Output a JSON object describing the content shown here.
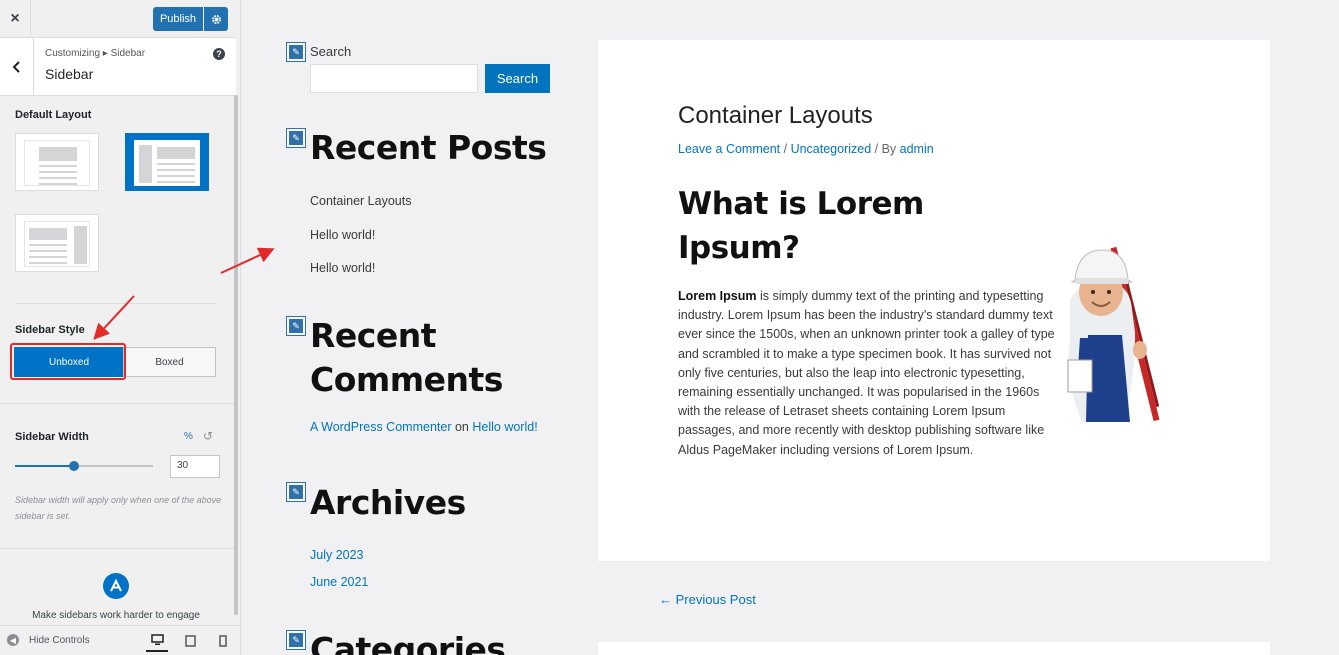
{
  "header": {
    "close_icon": "×",
    "publish_label": "Publish",
    "settings_icon": "gear-icon"
  },
  "section": {
    "breadcrumb": "Customizing ▸ Sidebar",
    "title": "Sidebar"
  },
  "controls": {
    "default_layout_label": "Default Layout",
    "selected_layout_index": 1,
    "sidebar_style_label": "Sidebar Style",
    "style_options": [
      "Unboxed",
      "Boxed"
    ],
    "selected_style": "Unboxed",
    "sidebar_width_label": "Sidebar Width",
    "width_unit": "%",
    "width_value": "30",
    "width_fraction": 0.43,
    "width_help": "Sidebar width will apply only when one of the above sidebar is set.",
    "promo_text": "Make sidebars work harder to engage"
  },
  "footer": {
    "hide_controls_label": "Hide Controls"
  },
  "preview": {
    "search_label": "Search",
    "search_button": "Search",
    "recent_posts_title": "Recent Posts",
    "recent_posts": [
      "Container Layouts",
      "Hello world!",
      "Hello world!"
    ],
    "recent_comments_title": "Recent Comments",
    "comment_author": "A WordPress Commenter",
    "comment_on": "on",
    "comment_post": "Hello world!",
    "archives_title": "Archives",
    "archives": [
      "July 2023",
      "June 2021"
    ],
    "categories_title": "Categories",
    "post_title": "Container Layouts",
    "meta_comment": "Leave a Comment",
    "meta_sep": " / ",
    "meta_category": "Uncategorized",
    "meta_by": " / By ",
    "meta_author": "admin",
    "lorem_heading": "What is Lorem Ipsum?",
    "lorem_bold": "Lorem Ipsum",
    "lorem_text": " is simply dummy text of the printing and typesetting industry. Lorem Ipsum has been the industry’s standard dummy text ever since the 1500s, when an unknown printer took a galley of type and scrambled it to make a type specimen book. It has survived not only five centuries, but also the leap into electronic typesetting, remaining essentially unchanged. It was popularised in the 1960s with the release of Letraset sheets containing Lorem Ipsum passages, and more recently with desktop publishing software like Aldus PageMaker including versions of Lorem Ipsum.",
    "previous_post": "← Previous Post"
  },
  "colors": {
    "accent": "#0073c6",
    "link": "#0274be",
    "highlight": "#e22a2a"
  }
}
